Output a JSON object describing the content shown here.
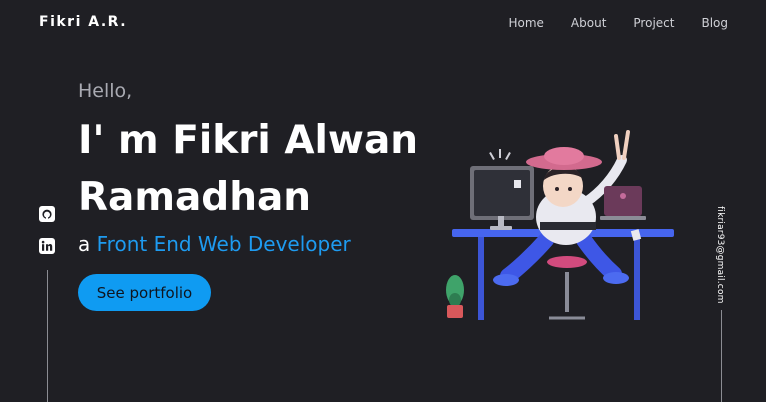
{
  "brand": "Fikri A.R.",
  "nav": {
    "items": [
      {
        "label": "Home"
      },
      {
        "label": "About"
      },
      {
        "label": "Project"
      },
      {
        "label": "Blog"
      }
    ]
  },
  "hero": {
    "greeting": "Hello,",
    "headline": "I' m Fikri Alwan Ramadhan",
    "role_prefix": "a",
    "role": "Front End Web Developer",
    "cta_label": "See portfolio"
  },
  "social": {
    "icons": [
      "github-icon",
      "linkedin-icon"
    ]
  },
  "email": "fikriar93@gmail.com",
  "colors": {
    "background": "#1f1f24",
    "accent": "#1e9bf0",
    "button": "#0f9bf2"
  }
}
